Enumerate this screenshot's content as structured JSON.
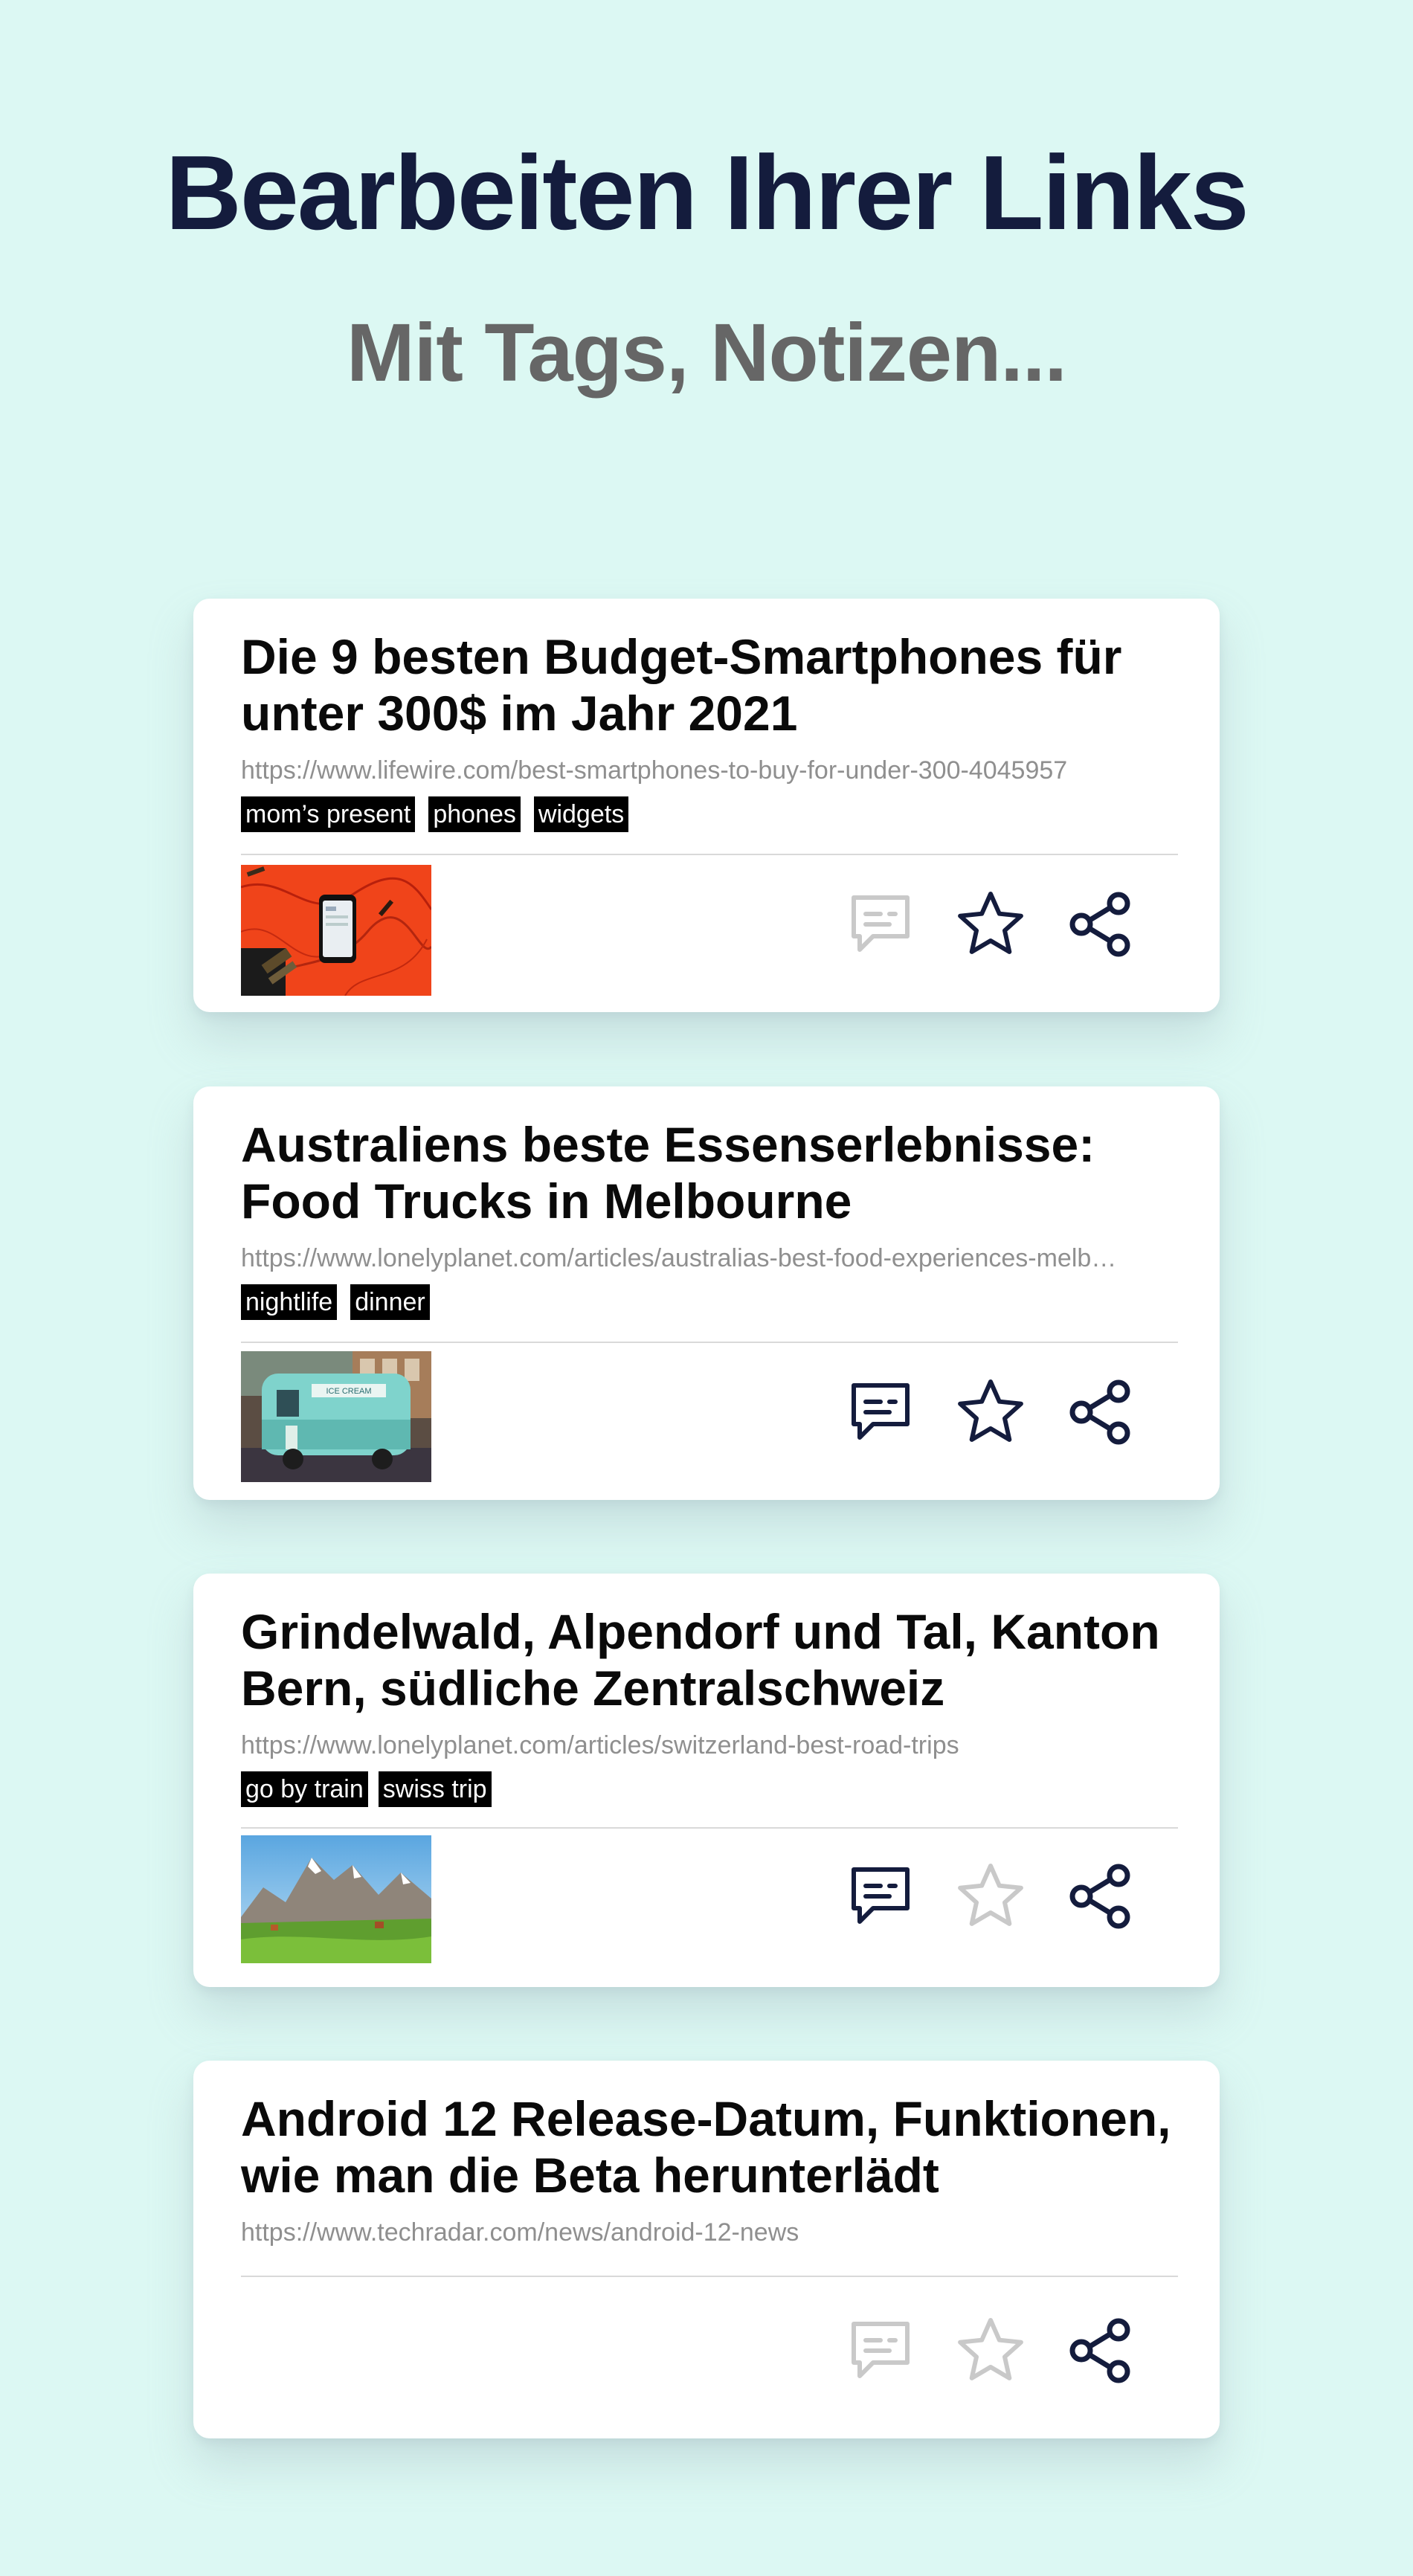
{
  "header": {
    "title": "Bearbeiten Ihrer Links",
    "subtitle": "Mit Tags, Notizen..."
  },
  "colors": {
    "background": "#dcf8f3",
    "title": "#141c3d",
    "icon_active": "#141c3d",
    "icon_inactive": "#c9c9c9",
    "tag_background": "#000000"
  },
  "links": [
    {
      "title": "Die 9 besten Budget-Smartphones für unter 300$ im Jahr 2021",
      "url": "https://www.lifewire.com/best-smartphones-to-buy-for-under-300-4045957",
      "tags": [
        "mom’s present",
        "phones",
        "widgets"
      ],
      "thumbnail": "smartphone-on-orange-background",
      "note_icon": "note-icon",
      "note_active": false,
      "star_icon": "star-icon",
      "favorite": true,
      "share_icon": "share-icon"
    },
    {
      "title": "Australiens beste Essenserlebnisse: Food Trucks in Melbourne",
      "url": "https://www.lonelyplanet.com/articles/australias-best-food-experiences-melb…",
      "tags": [
        "nightlife",
        "dinner"
      ],
      "thumbnail": "food-truck-caravan",
      "thumbnail_sign": "ICE CREAM",
      "note_icon": "note-icon",
      "note_active": true,
      "star_icon": "star-icon",
      "favorite": true,
      "share_icon": "share-icon"
    },
    {
      "title": "Grindelwald, Alpendorf und Tal, Kanton Bern, südliche Zentralschweiz",
      "url": "https://www.lonelyplanet.com/articles/switzerland-best-road-trips",
      "tags": [
        "go by train",
        "swiss trip"
      ],
      "thumbnail": "alpine-mountain-meadow",
      "note_icon": "note-icon",
      "note_active": true,
      "star_icon": "star-icon",
      "favorite": false,
      "share_icon": "share-icon"
    },
    {
      "title": "Android 12 Release-Datum, Funktionen, wie man die Beta herunterlädt",
      "url": "https://www.techradar.com/news/android-12-news",
      "tags": [],
      "thumbnail": "",
      "note_icon": "note-icon",
      "note_active": false,
      "star_icon": "star-icon",
      "favorite": false,
      "share_icon": "share-icon"
    }
  ]
}
